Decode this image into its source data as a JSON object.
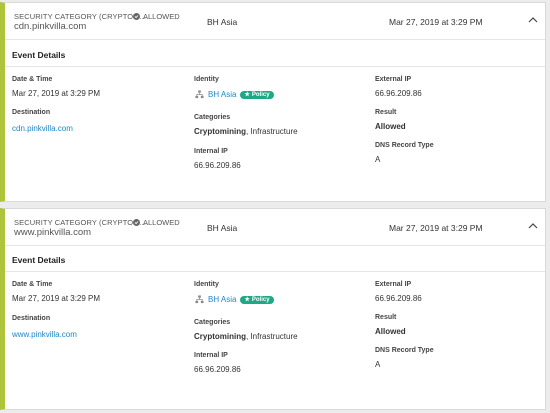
{
  "cards": [
    {
      "security_category": "SECURITY CATEGORY (CRYPTOM...",
      "status": "ALLOWED",
      "domain": "cdn.pinkvilla.com",
      "identity": "BH Asia",
      "datetime": "Mar 27, 2019 at 3:29 PM",
      "details": {
        "title": "Event Details",
        "date_label": "Date & Time",
        "date_value": "Mar 27, 2019 at 3:29 PM",
        "destination_label": "Destination",
        "destination_value": "cdn.pinkvilla.com",
        "identity_label": "Identity",
        "identity_value": "BH Asia",
        "policy_badge": "Policy",
        "categories_label": "Categories",
        "categories_primary": "Cryptomining",
        "categories_rest": ", Infrastructure",
        "internal_ip_label": "Internal IP",
        "internal_ip_value": "66.96.209.86",
        "external_ip_label": "External IP",
        "external_ip_value": "66.96.209.86",
        "result_label": "Result",
        "result_value": "Allowed",
        "dns_label": "DNS Record Type",
        "dns_value": "A"
      }
    },
    {
      "security_category": "SECURITY CATEGORY (CRYPTOM...",
      "status": "ALLOWED",
      "domain": "www.pinkvilla.com",
      "identity": "BH Asia",
      "datetime": "Mar 27, 2019 at 3:29 PM",
      "details": {
        "title": "Event Details",
        "date_label": "Date & Time",
        "date_value": "Mar 27, 2019 at 3:29 PM",
        "destination_label": "Destination",
        "destination_value": "www.pinkvilla.com",
        "identity_label": "Identity",
        "identity_value": "BH Asia",
        "policy_badge": "Policy",
        "categories_label": "Categories",
        "categories_primary": "Cryptomining",
        "categories_rest": ", Infrastructure",
        "internal_ip_label": "Internal IP",
        "internal_ip_value": "66.96.209.86",
        "external_ip_label": "External IP",
        "external_ip_value": "66.96.209.86",
        "result_label": "Result",
        "result_value": "Allowed",
        "dns_label": "DNS Record Type",
        "dns_value": "A"
      }
    }
  ],
  "colors": {
    "accent_bar": "#aec43b",
    "link": "#1f88c9",
    "policy_badge": "#1fa886"
  }
}
